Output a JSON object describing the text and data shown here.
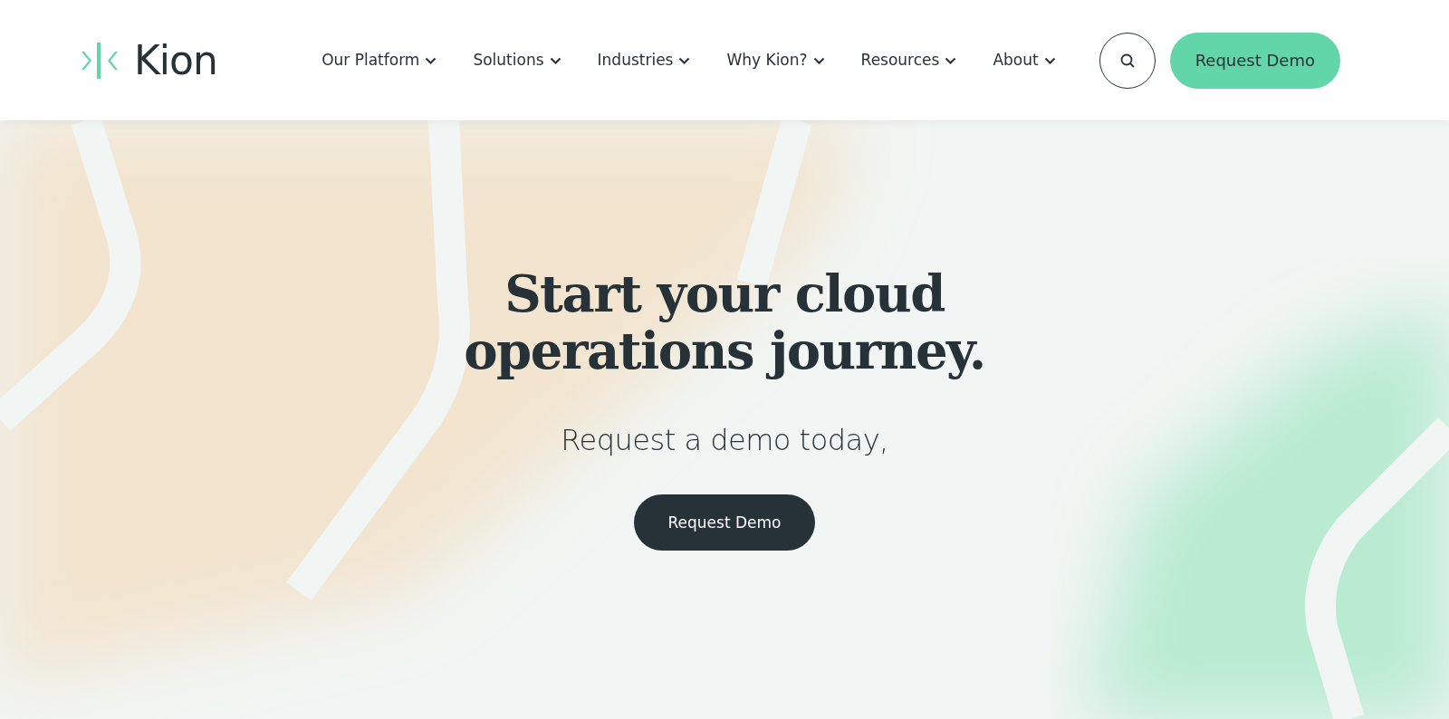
{
  "logo": {
    "text": "Kion"
  },
  "nav": [
    {
      "label": "Our Platform"
    },
    {
      "label": "Solutions"
    },
    {
      "label": "Industries"
    },
    {
      "label": "Why Kion?"
    },
    {
      "label": "Resources"
    },
    {
      "label": "About"
    }
  ],
  "header_button": "Request Demo",
  "hero": {
    "title": "Start your cloud operations journey.",
    "subtitle": "Request a demo today,",
    "button": "Request Demo"
  }
}
